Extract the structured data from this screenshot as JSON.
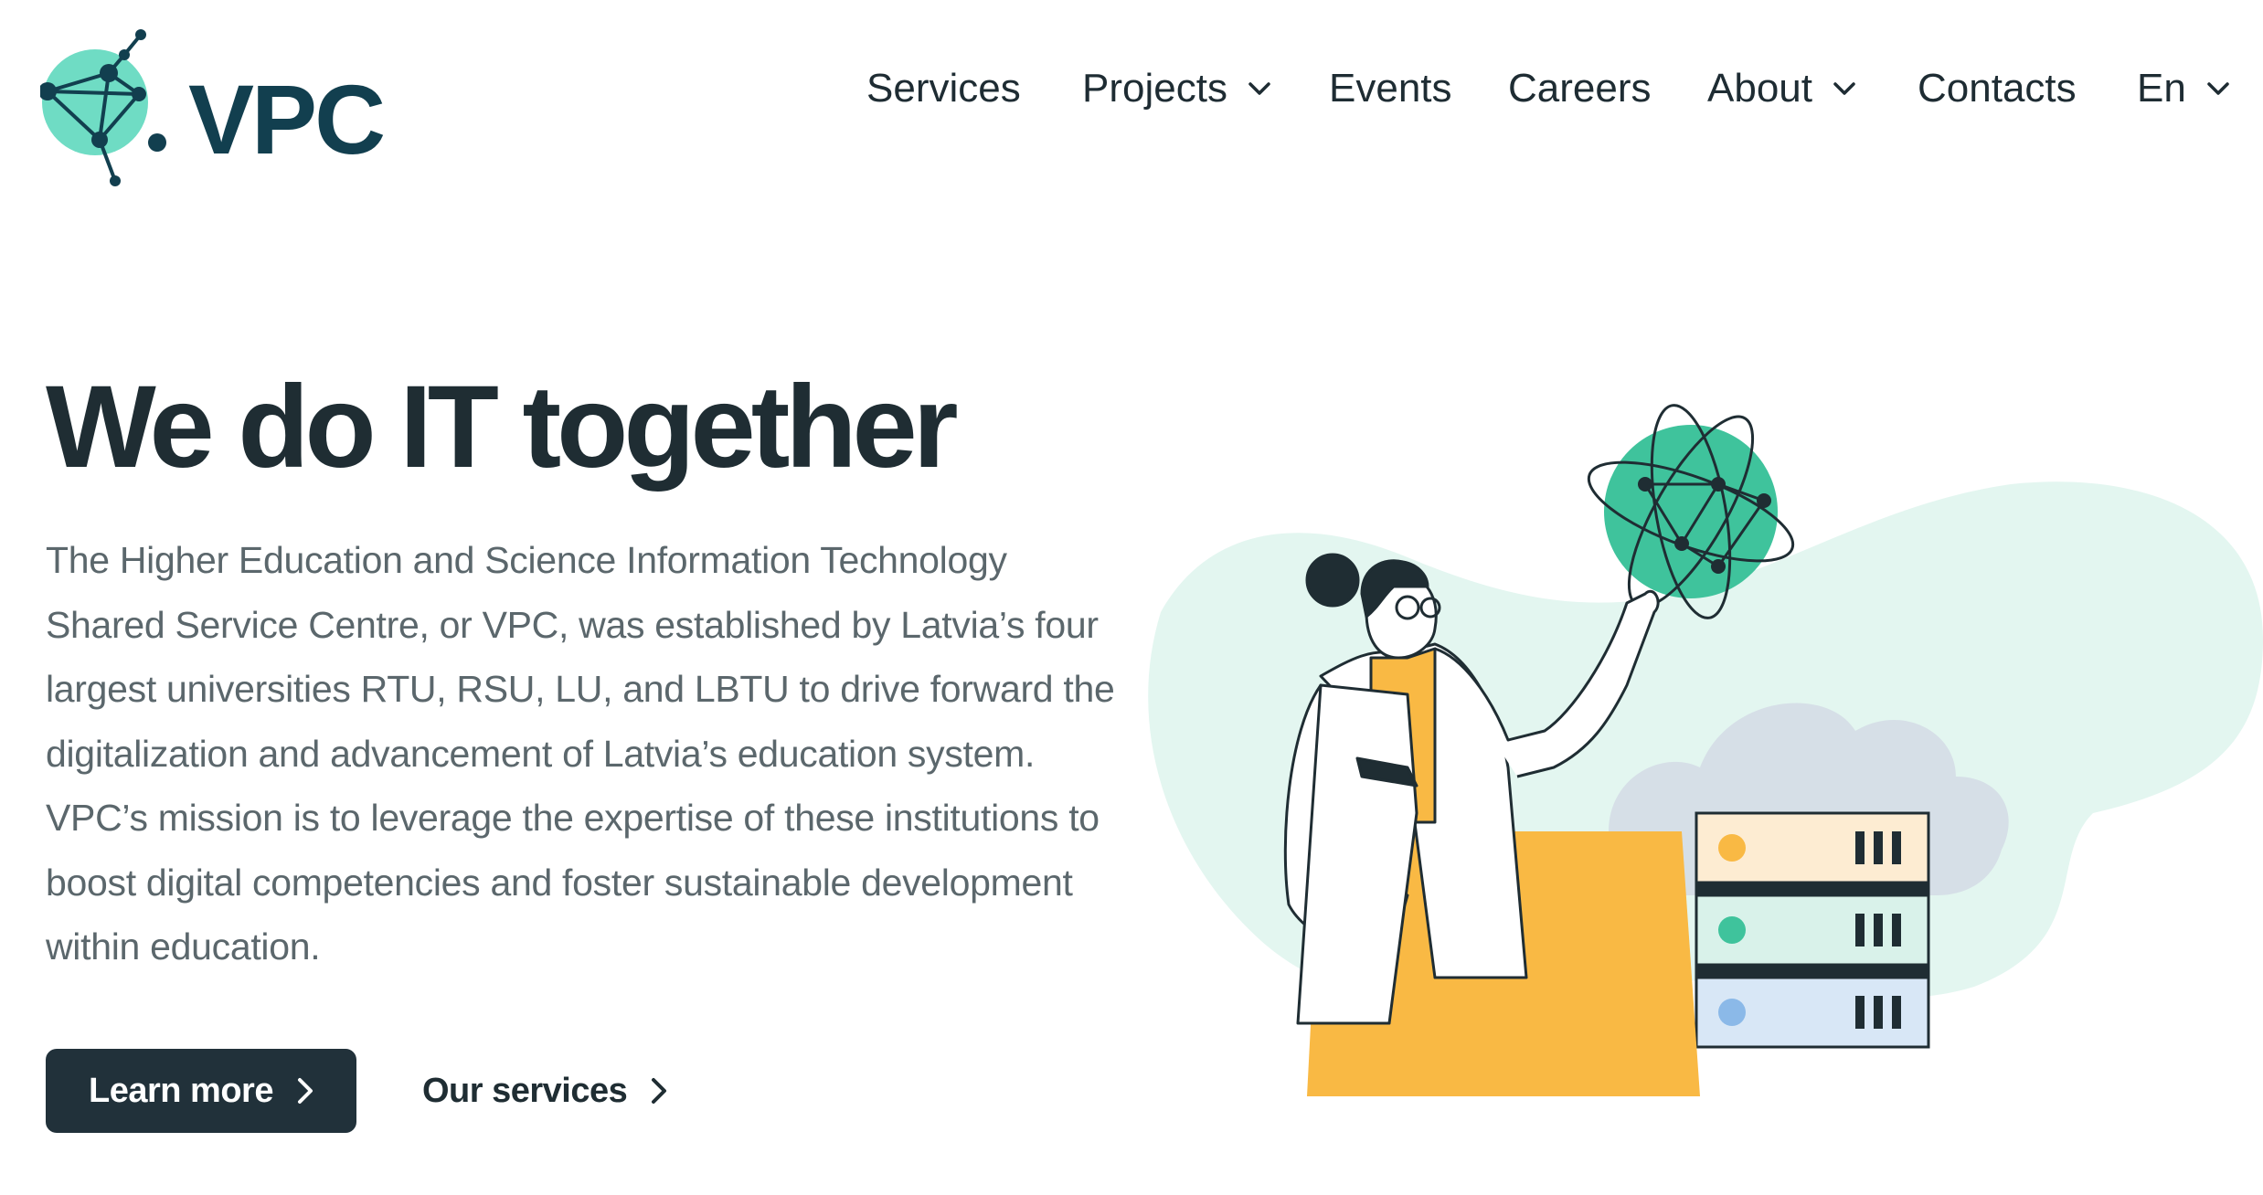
{
  "brand": {
    "name": "VPC",
    "primary_color": "#123f4f",
    "accent_color": "#46c3a2"
  },
  "nav": {
    "items": [
      {
        "label": "Services",
        "has_dropdown": false
      },
      {
        "label": "Projects",
        "has_dropdown": true
      },
      {
        "label": "Events",
        "has_dropdown": false
      },
      {
        "label": "Careers",
        "has_dropdown": false
      },
      {
        "label": "About",
        "has_dropdown": true
      },
      {
        "label": "Contacts",
        "has_dropdown": false
      },
      {
        "label": "En",
        "has_dropdown": true
      }
    ]
  },
  "hero": {
    "title": "We do IT together",
    "body": "The Higher Education and Science Information Technology Shared Service Centre, or VPC, was established by Latvia’s four largest universities RTU, RSU, LU, and LBTU to drive forward the digitalization and advancement of Latvia’s education system. VPC’s mission is to leverage the expertise of these institutions to boost digital competencies and foster sustainable development within education.",
    "primary_button": "Learn more",
    "secondary_link": "Our services"
  },
  "illustration": {
    "icons": [
      "globe-network-icon",
      "cloud-icon",
      "server-stack-icon",
      "person-illustration"
    ],
    "colors": {
      "teal": "#46c3a2",
      "mint_bg": "#e3f6f0",
      "orange": "#f9b944",
      "cloud": "#d6dfe7"
    }
  }
}
